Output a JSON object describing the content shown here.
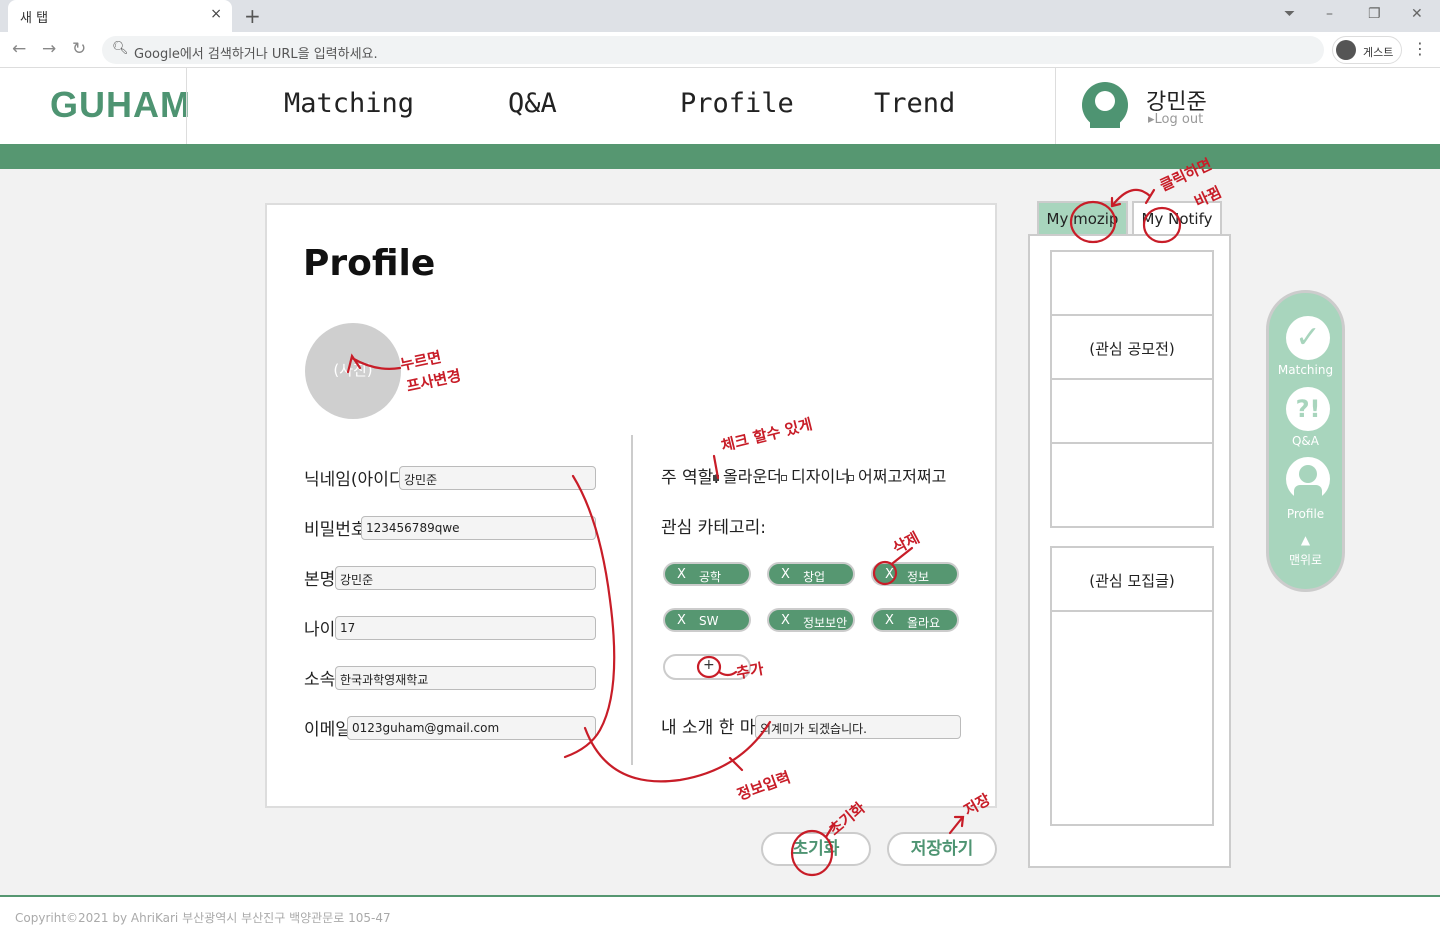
{
  "browser": {
    "tab_title": "새 탭",
    "tab_close": "×",
    "new_tab": "+",
    "address_placeholder": "Google에서 검색하거나 URL을 입력하세요.",
    "profile_label": "게스트"
  },
  "header": {
    "logo": "GUHAM",
    "nav": [
      "Matching",
      "Q&A",
      "Profile",
      "Trend"
    ],
    "user_name": "강민준",
    "logout": "Log out"
  },
  "profile": {
    "title": "Profile",
    "photo_label": "(사진)",
    "fields": [
      {
        "label": "닉네임(아이디):",
        "value": "강민준"
      },
      {
        "label": "비밀번호:",
        "value": "123456789qwe"
      },
      {
        "label": "본명:",
        "value": "강민준"
      },
      {
        "label": "나이:",
        "value": "17"
      },
      {
        "label": "소속:",
        "value": "한국과학영재학교"
      },
      {
        "label": "이메일:",
        "value": "0123guham@gmail.com"
      }
    ],
    "role_label": "주 역할:",
    "roles": [
      {
        "label": "올라운더",
        "checked": true
      },
      {
        "label": "디자이너",
        "checked": false
      },
      {
        "label": "어쩌고저쩌고",
        "checked": false
      }
    ],
    "category_label": "관심 카테고리:",
    "chips": [
      "공학",
      "창업",
      "정보",
      "SW",
      "정보보안",
      "올라요"
    ],
    "chip_remove": "X",
    "add_chip": "+",
    "intro_label": "내 소개 한 마디:",
    "intro_value": "외계미가 되겠습니다."
  },
  "actions": {
    "reset": "초기화",
    "save": "저장하기"
  },
  "panel": {
    "tabs": [
      "My mozip",
      "My Notify"
    ],
    "slot_interest_contest": "(관심 공모전)",
    "slot_interest_post": "(관심 모집글)"
  },
  "quick_menu": {
    "items": [
      "Matching",
      "Q&A",
      "Profile"
    ],
    "qa_glyph": "?!",
    "top": "맨위로"
  },
  "annotations": {
    "photo": "누르면",
    "photo2": "프사변경",
    "role": "체크 할수 있게",
    "delete": "삭제",
    "add": "추가",
    "info": "정보입력",
    "reset": "초기화",
    "save": "저장",
    "tab_switch": "클릭하면",
    "tab_switch2": "바뀜"
  },
  "footer": {
    "text": "Copyriht©2021 by AhriKari  부산광역시 부산진구 백양관문로 105-47"
  },
  "colors": {
    "brand_green": "#569771",
    "light_green": "#a8d5bd",
    "annotation_red": "#c81d28"
  }
}
